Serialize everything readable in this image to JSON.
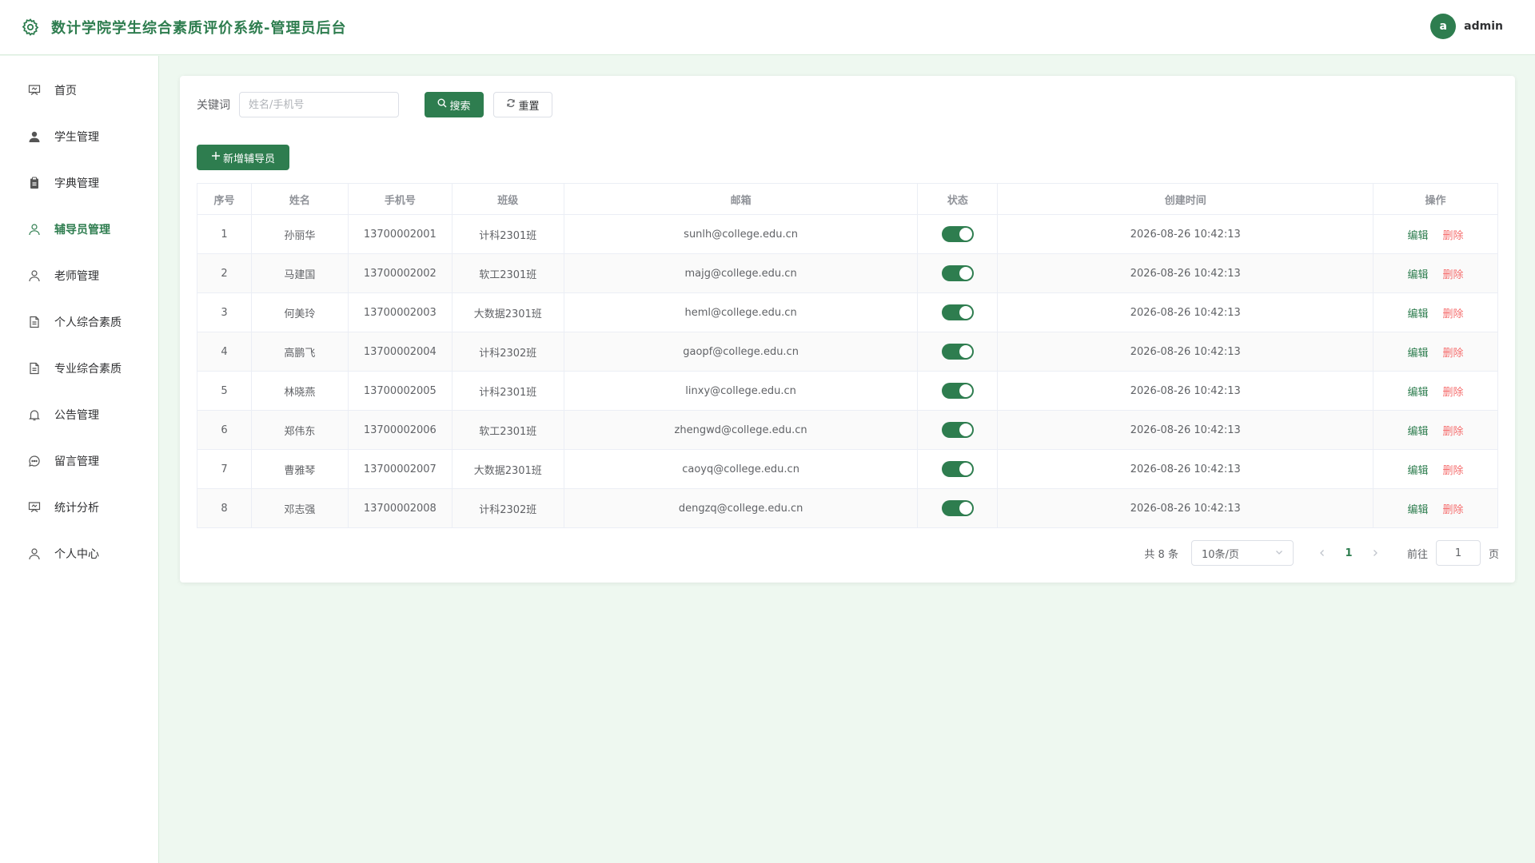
{
  "header": {
    "title": "数计学院学生综合素质评价系统-管理员后台",
    "avatar_letter": "a",
    "username": "admin"
  },
  "sidebar": {
    "active": 3,
    "items": [
      {
        "label": "首页",
        "icon": "presentation-icon"
      },
      {
        "label": "学生管理",
        "icon": "user-filled-icon"
      },
      {
        "label": "字典管理",
        "icon": "clipboard-icon"
      },
      {
        "label": "辅导员管理",
        "icon": "user-icon"
      },
      {
        "label": "老师管理",
        "icon": "user-icon"
      },
      {
        "label": "个人综合素质",
        "icon": "document-icon"
      },
      {
        "label": "专业综合素质",
        "icon": "document-icon"
      },
      {
        "label": "公告管理",
        "icon": "bell-icon"
      },
      {
        "label": "留言管理",
        "icon": "chat-icon"
      },
      {
        "label": "统计分析",
        "icon": "presentation-icon"
      },
      {
        "label": "个人中心",
        "icon": "user-icon"
      }
    ]
  },
  "search": {
    "label": "关键词",
    "placeholder": "姓名/手机号",
    "value": "",
    "search_button": "搜索",
    "reset_button": "重置"
  },
  "add_button": "新增辅导员",
  "table": {
    "columns": [
      "序号",
      "姓名",
      "手机号",
      "班级",
      "邮箱",
      "状态",
      "创建时间",
      "操作"
    ],
    "edit_label": "编辑",
    "delete_label": "删除",
    "rows": [
      {
        "no": "1",
        "name": "孙丽华",
        "phone": "13700002001",
        "class": "计科2301班",
        "email": "sunlh@college.edu.cn",
        "enabled": true,
        "created": "2026-08-26 10:42:13"
      },
      {
        "no": "2",
        "name": "马建国",
        "phone": "13700002002",
        "class": "软工2301班",
        "email": "majg@college.edu.cn",
        "enabled": true,
        "created": "2026-08-26 10:42:13"
      },
      {
        "no": "3",
        "name": "何美玲",
        "phone": "13700002003",
        "class": "大数据2301班",
        "email": "heml@college.edu.cn",
        "enabled": true,
        "created": "2026-08-26 10:42:13"
      },
      {
        "no": "4",
        "name": "高鹏飞",
        "phone": "13700002004",
        "class": "计科2302班",
        "email": "gaopf@college.edu.cn",
        "enabled": true,
        "created": "2026-08-26 10:42:13"
      },
      {
        "no": "5",
        "name": "林晓燕",
        "phone": "13700002005",
        "class": "计科2301班",
        "email": "linxy@college.edu.cn",
        "enabled": true,
        "created": "2026-08-26 10:42:13"
      },
      {
        "no": "6",
        "name": "郑伟东",
        "phone": "13700002006",
        "class": "软工2301班",
        "email": "zhengwd@college.edu.cn",
        "enabled": true,
        "created": "2026-08-26 10:42:13"
      },
      {
        "no": "7",
        "name": "曹雅琴",
        "phone": "13700002007",
        "class": "大数据2301班",
        "email": "caoyq@college.edu.cn",
        "enabled": true,
        "created": "2026-08-26 10:42:13"
      },
      {
        "no": "8",
        "name": "邓志强",
        "phone": "13700002008",
        "class": "计科2302班",
        "email": "dengzq@college.edu.cn",
        "enabled": true,
        "created": "2026-08-26 10:42:13"
      }
    ]
  },
  "pagination": {
    "total_text": "共 8 条",
    "page_size": "10条/页",
    "current_page": "1",
    "goto_label": "前往",
    "goto_value": "1",
    "page_suffix": "页"
  },
  "colors": {
    "primary": "#2e7d4f",
    "danger": "#f56c6c",
    "background": "#eef8f0"
  }
}
